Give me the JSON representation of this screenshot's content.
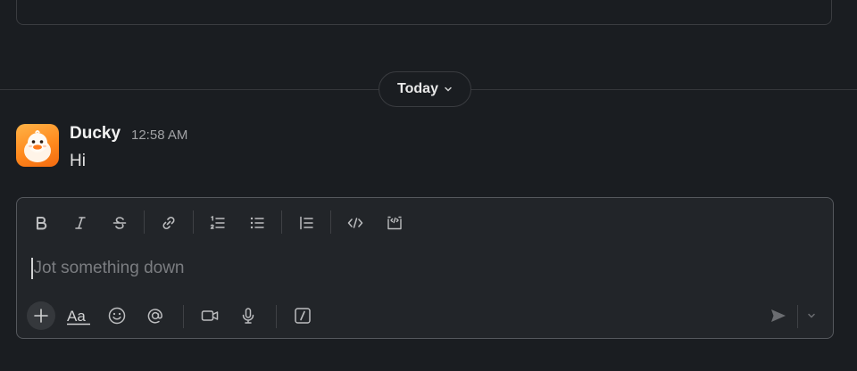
{
  "day_divider": {
    "label": "Today",
    "icon": "chevron-down-icon"
  },
  "message": {
    "author": "Ducky",
    "time": "12:58 AM",
    "text": "Hi",
    "avatar": "duck-avatar"
  },
  "composer": {
    "placeholder": "Jot something down",
    "formatting_toolbar": [
      "bold-icon",
      "italic-icon",
      "strikethrough-icon",
      "link-icon",
      "ordered-list-icon",
      "bulleted-list-icon",
      "blockquote-icon",
      "code-icon",
      "code-block-icon"
    ],
    "bottom_actions": [
      "plus-icon",
      "formatting-toggle-icon",
      "emoji-icon",
      "mention-icon",
      "video-icon",
      "microphone-icon",
      "slash-command-icon",
      "send-icon",
      "chevron-down-icon"
    ]
  },
  "colors": {
    "background": "#1a1d21",
    "composer_bg": "#222529",
    "avatar_orange": "#ff8a1e"
  }
}
